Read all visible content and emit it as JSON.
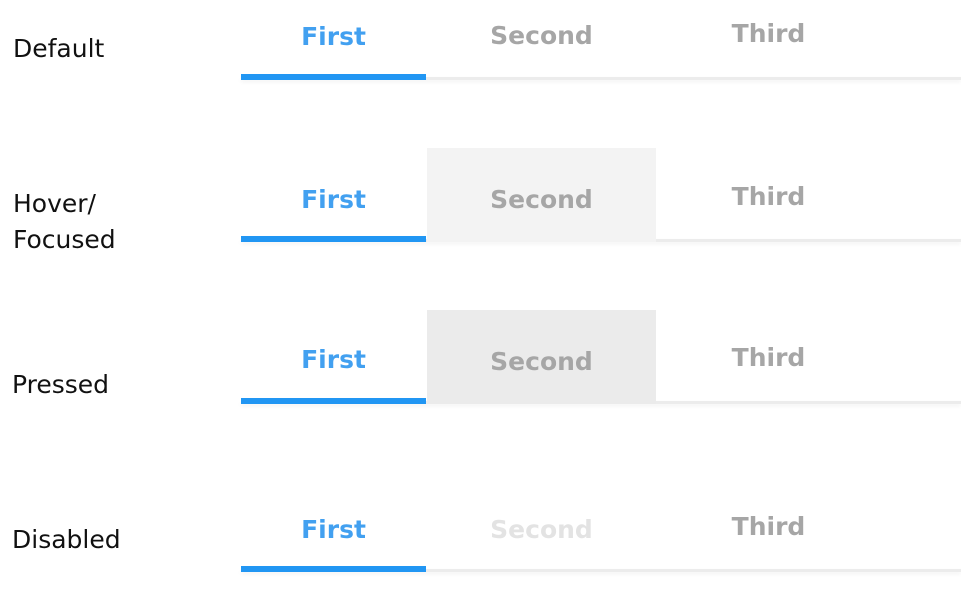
{
  "states": [
    {
      "label": "Default",
      "tabs": [
        "First",
        "Second",
        "Third"
      ]
    },
    {
      "label": "Hover/\nFocused",
      "tabs": [
        "First",
        "Second",
        "Third"
      ]
    },
    {
      "label": "Pressed",
      "tabs": [
        "First",
        "Second",
        "Third"
      ]
    },
    {
      "label": "Disabled",
      "tabs": [
        "First",
        "Second",
        "Third"
      ]
    }
  ],
  "colors": {
    "active_text": "#42a0f0",
    "indicator": "#2196f3",
    "inactive_text": "#a6a6a6",
    "disabled_text": "#e3e3e3",
    "hover_bg": "#f3f3f3",
    "pressed_bg": "#ebebeb",
    "baseline": "#ececec"
  }
}
